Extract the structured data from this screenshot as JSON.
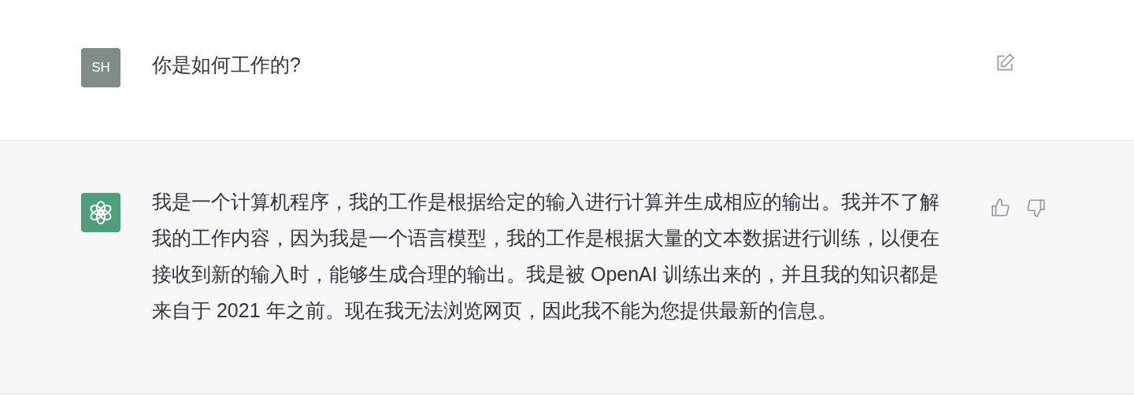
{
  "messages": [
    {
      "kind": "user",
      "avatar": "SH",
      "lines": [
        "你是如何工作的?"
      ]
    },
    {
      "kind": "assistant",
      "lines": [
        "我是一个计算机程序，我的工作是根据给定的输入进行计算并生成相应的输出。我并不了解",
        "我的工作内容，因为我是一个语言模型，我的工作是根据大量的文本数据进行训练，以便在",
        "接收到新的输入时，能够生成合理的输出。我是被 OpenAI 训练出来的，并且我的知识都是",
        "来自于 2021 年之前。现在我无法浏览网页，因此我不能为您提供最新的信息。"
      ]
    }
  ]
}
